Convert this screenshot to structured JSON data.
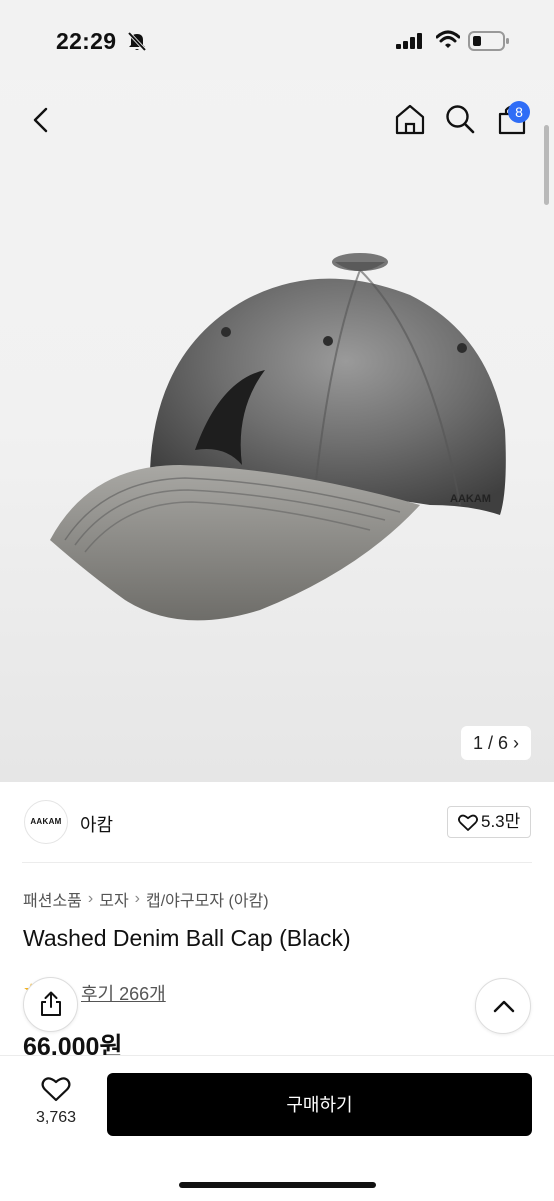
{
  "status": {
    "time": "22:29",
    "icons": [
      "bell-slash-icon",
      "cellular-signal-icon",
      "wifi-icon",
      "battery-icon"
    ]
  },
  "nav": {
    "back_icon": "chevron-left-icon",
    "home_icon": "home-icon",
    "search_icon": "search-icon",
    "cart_icon": "shopping-bag-icon",
    "cart_count": "8"
  },
  "gallery": {
    "pager": "1 / 6",
    "cap_logo_text": "AAKAM"
  },
  "brand": {
    "logo_text": "AAKAM",
    "name": "아캄",
    "likes": "5.3만",
    "like_icon": "heart-icon"
  },
  "product": {
    "breadcrumb": [
      "패션소품",
      "모자",
      "캡/야구모자 (아캄)"
    ],
    "title": "Washed Denim Ball Cap (Black)",
    "reviews": "후기 266개",
    "price": "66,000원"
  },
  "fabs": {
    "share_icon": "share-icon",
    "top_icon": "chevron-up-icon"
  },
  "bottom": {
    "wish_count": "3,763",
    "buy_label": "구매하기"
  },
  "colors": {
    "badge": "#2f6df6",
    "buy_button": "#000000",
    "star": "#f3b21d"
  }
}
